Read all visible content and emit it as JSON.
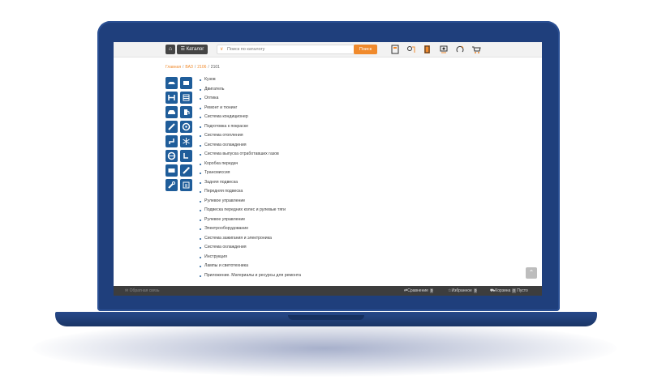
{
  "topbar": {
    "home_icon": "home-icon",
    "catalog_label": "☰ Каталог",
    "search_placeholder": "Поиск по каталогу",
    "search_button": "Поиск",
    "tool_icons": [
      "book-icon",
      "parts-icon",
      "manual-icon",
      "diagnostics-icon",
      "reset-icon",
      "cart-icon"
    ]
  },
  "breadcrumb": {
    "items": [
      "Главная",
      "ВАЗ",
      "2106"
    ],
    "current": "2101"
  },
  "categories": [
    "Кузов",
    "Двигатель",
    "Оптика",
    "Ремонт и тюнинг",
    "Система кондиционер",
    "Подготовка к покраске",
    "Система отопления",
    "Система охлаждения",
    "Система выпуска отработавших газов",
    "Коробка передач",
    "Трансмиссия",
    "Задняя подвеска",
    "Передняя подвеска",
    "Рулевое управление",
    "Подвеска передних колес и рулевые тяги",
    "Рулевое управление",
    "Электрооборудование",
    "Система зажигания и электроника",
    "Система охлаждения",
    "Инструкция",
    "Лампы и светотехника",
    "Приложение. Материалы и ресурсы для ремонта"
  ],
  "footer": {
    "feedback": "Обратная связь",
    "compare_label": "Сравнение",
    "compare_count": "0",
    "favorites_label": "Избранное",
    "favorites_count": "0",
    "cart_label": "Корзина",
    "cart_count": "0",
    "cart_status": "Пусто"
  },
  "colors": {
    "accent": "#f08a2c",
    "icon_blue": "#1f5d9a",
    "laptop_body": "#1f3f7c"
  }
}
